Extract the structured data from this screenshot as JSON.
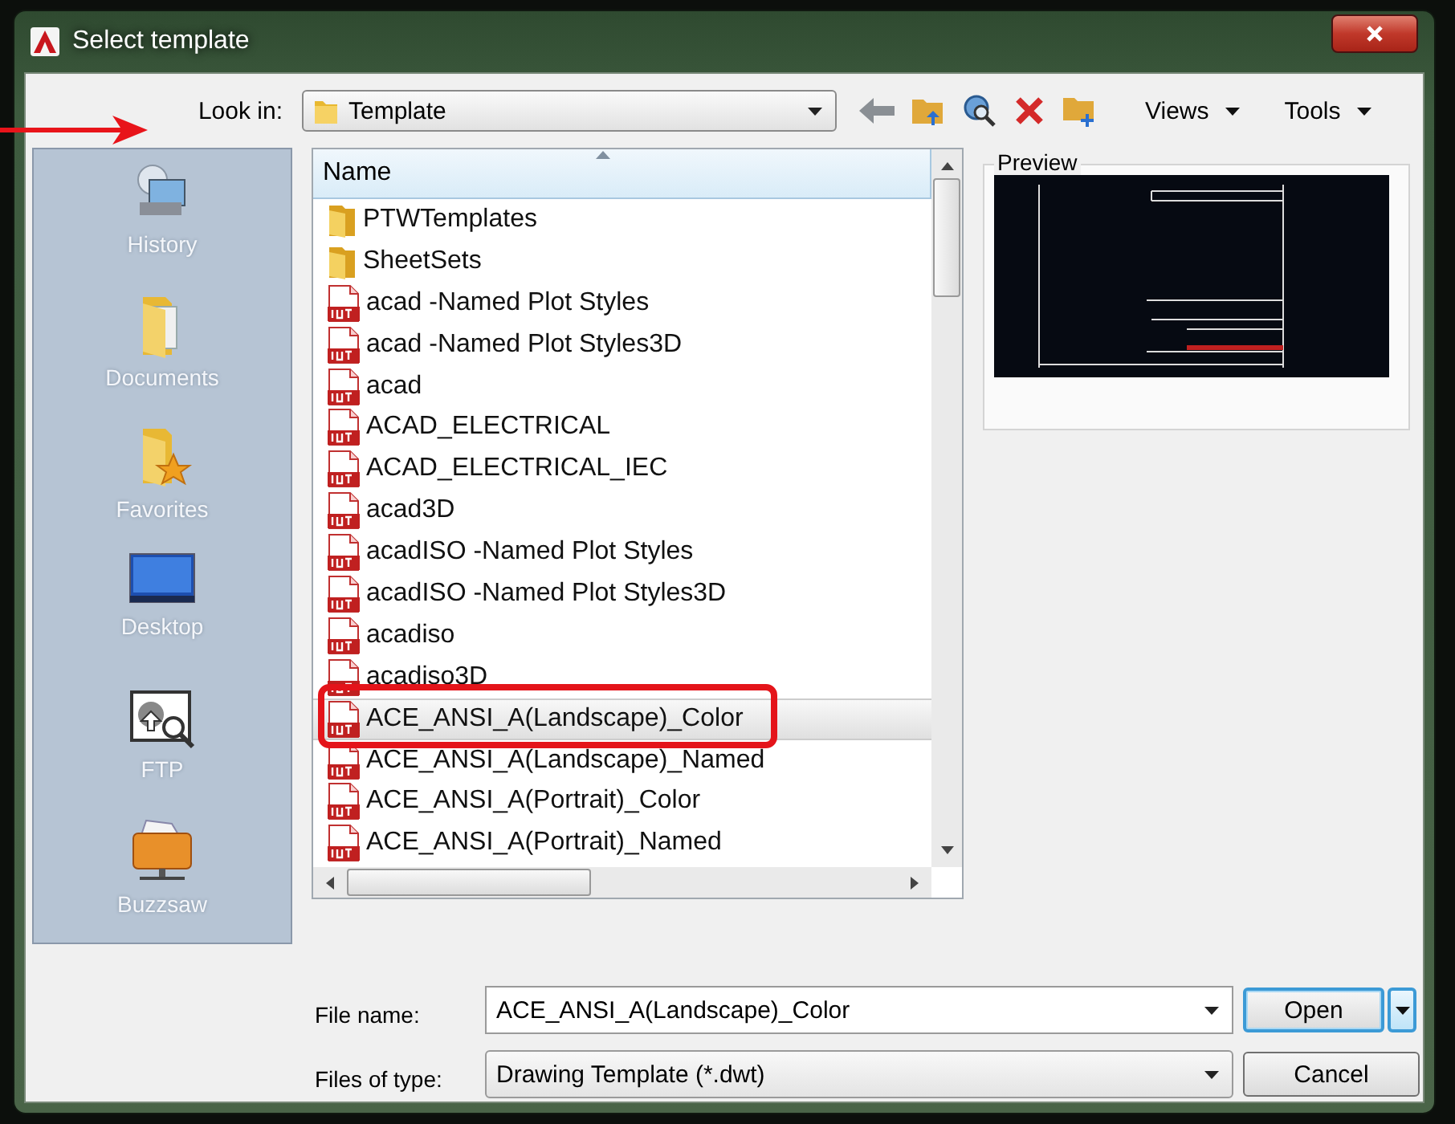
{
  "window": {
    "title": "Select template"
  },
  "look_in": {
    "label": "Look in:",
    "value": "Template"
  },
  "toolbar": {
    "views": "Views",
    "tools": "Tools"
  },
  "places": [
    {
      "label": "History",
      "kind": "history"
    },
    {
      "label": "Documents",
      "kind": "documents"
    },
    {
      "label": "Favorites",
      "kind": "favorites"
    },
    {
      "label": "Desktop",
      "kind": "desktop"
    },
    {
      "label": "FTP",
      "kind": "ftp"
    },
    {
      "label": "Buzzsaw",
      "kind": "buzzsaw"
    }
  ],
  "file_list": {
    "columns": [
      {
        "label": "Name"
      }
    ],
    "rows": [
      {
        "name": "PTWTemplates",
        "kind": "folder",
        "selected": false
      },
      {
        "name": "SheetSets",
        "kind": "folder",
        "selected": false
      },
      {
        "name": "acad -Named Plot Styles",
        "kind": "dwt",
        "selected": false
      },
      {
        "name": "acad -Named Plot Styles3D",
        "kind": "dwt",
        "selected": false
      },
      {
        "name": "acad",
        "kind": "dwt",
        "selected": false
      },
      {
        "name": "ACAD_ELECTRICAL",
        "kind": "dwt",
        "selected": false
      },
      {
        "name": "ACAD_ELECTRICAL_IEC",
        "kind": "dwt",
        "selected": false
      },
      {
        "name": "acad3D",
        "kind": "dwt",
        "selected": false
      },
      {
        "name": "acadISO -Named Plot Styles",
        "kind": "dwt",
        "selected": false
      },
      {
        "name": "acadISO -Named Plot Styles3D",
        "kind": "dwt",
        "selected": false
      },
      {
        "name": "acadiso",
        "kind": "dwt",
        "selected": false
      },
      {
        "name": "acadiso3D",
        "kind": "dwt",
        "selected": false
      },
      {
        "name": "ACE_ANSI_A(Landscape)_Color",
        "kind": "dwt",
        "selected": true
      },
      {
        "name": "ACE_ANSI_A(Landscape)_Named",
        "kind": "dwt",
        "selected": false
      },
      {
        "name": "ACE_ANSI_A(Portrait)_Color",
        "kind": "dwt",
        "selected": false
      },
      {
        "name": "ACE_ANSI_A(Portrait)_Named",
        "kind": "dwt",
        "selected": false
      }
    ]
  },
  "preview": {
    "label": "Preview"
  },
  "file_name": {
    "label": "File name:",
    "value": "ACE_ANSI_A(Landscape)_Color"
  },
  "file_type": {
    "label": "Files of type:",
    "value": "Drawing Template (*.dwt)"
  },
  "buttons": [
    {
      "label": "Open",
      "kind": "default"
    },
    {
      "label": "Cancel",
      "kind": "normal"
    }
  ]
}
